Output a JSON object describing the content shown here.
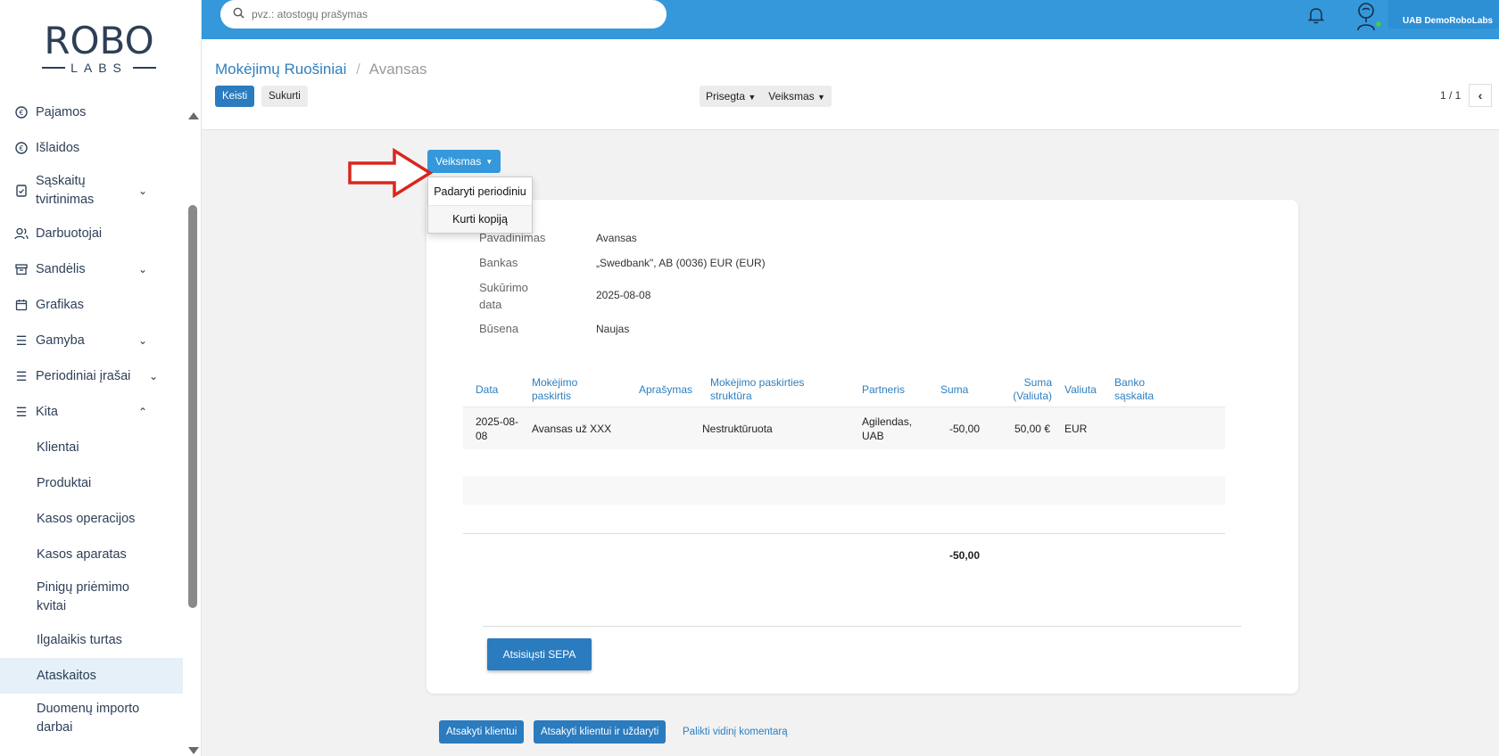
{
  "logo": {
    "top": "ROBO",
    "bottom": "LABS"
  },
  "search": {
    "placeholder": "pvz.: atostogų prašymas"
  },
  "header": {
    "company": "UAB DemoRoboLabs"
  },
  "sidebar": {
    "items": [
      {
        "label": "Pajamos",
        "icon": "income-icon"
      },
      {
        "label": "Išlaidos",
        "icon": "expense-icon"
      },
      {
        "label": "Sąskaitų tvirtinimas",
        "icon": "invoice-check-icon",
        "chevron": "down"
      },
      {
        "label": "Darbuotojai",
        "icon": "users-icon"
      },
      {
        "label": "Sandėlis",
        "icon": "warehouse-icon",
        "chevron": "down"
      },
      {
        "label": "Grafikas",
        "icon": "calendar-icon"
      },
      {
        "label": "Gamyba",
        "icon": "list-icon",
        "chevron": "down"
      },
      {
        "label": "Periodiniai įrašai",
        "icon": "list-icon",
        "chevron": "down"
      },
      {
        "label": "Kita",
        "icon": "list-icon",
        "chevron": "up"
      }
    ],
    "sub_items": [
      "Klientai",
      "Produktai",
      "Kasos operacijos",
      "Kasos aparatas",
      "Pinigų priėmimo kvitai",
      "Ilgalaikis turtas",
      "Ataskaitos",
      "Duomenų importo darbai"
    ],
    "active_sub_item": "Ataskaitos"
  },
  "breadcrumb": {
    "parent": "Mokėjimų Ruošiniai",
    "separator": "/",
    "current": "Avansas"
  },
  "control": {
    "edit_label": "Keisti",
    "create_label": "Sukurti",
    "attached_label": "Prisegta",
    "actions_label": "Veiksmas",
    "pager": "1 / 1"
  },
  "form_actions": {
    "button_label": "Veiksmas",
    "dropdown": [
      "Padaryti periodiniu",
      "Kurti kopiją"
    ]
  },
  "form": {
    "fields": [
      {
        "label": "Pavadinimas",
        "value": "Avansas"
      },
      {
        "label": "Bankas",
        "value": "„Swedbank\", AB (0036) EUR (EUR)"
      },
      {
        "label": "Sukūrimo data",
        "value": "2025-08-08"
      },
      {
        "label": "Būsena",
        "value": "Naujas"
      }
    ],
    "table": {
      "columns": [
        "Data",
        "Mokėjimo paskirtis",
        "Aprašymas",
        "Mokėjimo paskirties struktūra",
        "Partneris",
        "Suma",
        "Suma (Valiuta)",
        "Valiuta",
        "Banko sąskaita"
      ],
      "rows": [
        {
          "data": "2025-08-08",
          "paskirtis": "Avansas už XXX",
          "aprasymas": "",
          "struktura": "Nestruktūruota",
          "partneris": "Agilendas, UAB",
          "suma": "-50,00",
          "suma_valiuta": "50,00 €",
          "valiuta": "EUR",
          "banko_saskaita": ""
        }
      ],
      "total": "-50,00"
    },
    "sepa_button": "Atsisiųsti SEPA"
  },
  "chatter": {
    "reply_label": "Atsakyti klientui",
    "reply_close_label": "Atsakyti klientui ir uždaryti",
    "comment_label": "Palikti vidinį komentarą"
  },
  "colors": {
    "primary": "#3498db",
    "button": "#2b7bbf",
    "link": "#2e7fbf",
    "arrow": "#d9261c"
  }
}
